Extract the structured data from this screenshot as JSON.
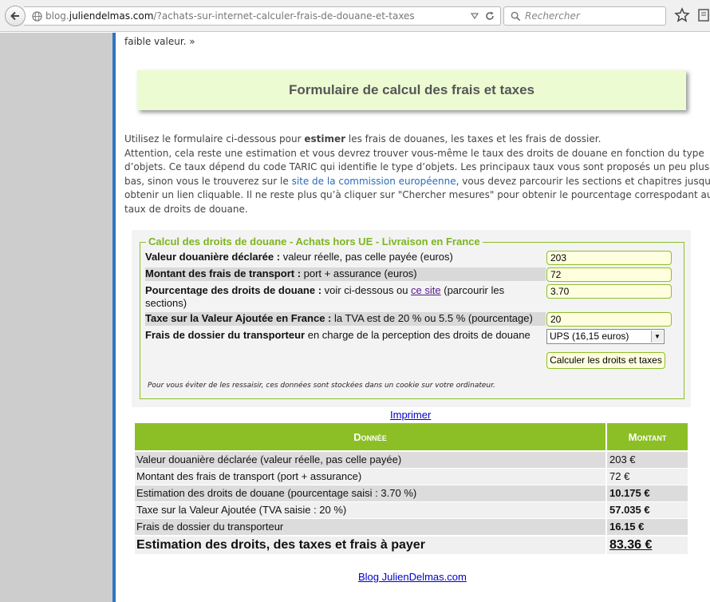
{
  "browser": {
    "url_prefix": "blog.",
    "url_domain": "juliendelmas.com",
    "url_path": "/?achats-sur-internet-calculer-frais-de-douane-et-taxes",
    "search_placeholder": "Rechercher"
  },
  "page": {
    "top_text": "faible valeur. »",
    "title": "Formulaire de calcul des frais et taxes",
    "intro": {
      "l1_a": "Utilisez le formulaire ci-dessous pour ",
      "l1_b": "estimer",
      "l1_c": " les frais de douanes, les taxes et les frais de dossier.",
      "l2": "Attention, cela reste une estimation et vous devrez trouver vous-même le taux des droits de douane en fonction du type",
      "l3": "d’objets. Ce taux dépend du code TARIC qui identifie le type d’objets. Les principaux taux vous sont proposés un peu plus",
      "l4_a": "bas, sinon vous le trouverez sur le ",
      "l4_link": "site de la commission européenne",
      "l4_b": ", vous devez parcourir les sections et chapitres jusqu’à",
      "l5": "obtenir un lien cliquable. Il ne reste plus qu’à cliquer sur \"Chercher mesures\" pour obtenir le pourcentage correspodant au",
      "l6": "taux de droits de douane."
    }
  },
  "form": {
    "legend": "Calcul des droits de douane - Achats hors UE - Livraison en France",
    "fields": [
      {
        "label_bold": "Valeur douanière déclarée :",
        "label_rest": " valeur réelle, pas celle payée (euros)",
        "value": "203"
      },
      {
        "label_bold": "Montant des frais de transport :",
        "label_rest": " port + assurance (euros)",
        "value": "72"
      },
      {
        "label_bold": "Pourcentage des droits de douane :",
        "label_rest": " voir ci-dessous ou ",
        "link": "ce site",
        "label_after": " (parcourir les",
        "label_line2": "sections)",
        "value": "3.70"
      },
      {
        "label_bold": "Taxe sur la Valeur Ajoutée en France :",
        "label_rest": " la TVA est de 20 % ou 5.5 % (pourcentage)",
        "value": "20"
      },
      {
        "label_bold": "Frais de dossier du transporteur",
        "label_rest": " en charge de la perception des droits de douane",
        "value": "UPS (16,15 euros)"
      }
    ],
    "submit_label": "Calculer les droits et taxes",
    "note": "Pour vous éviter de les ressaisir, ces données sont stockées dans un cookie sur votre ordinateur."
  },
  "print_label": "Imprimer",
  "results": {
    "headers": [
      "Donnée",
      "Montant"
    ],
    "rows": [
      {
        "label": "Valeur douanière déclarée (valeur réelle, pas celle payée)",
        "value": "203 €"
      },
      {
        "label": "Montant des frais de transport (port + assurance)",
        "value": "72 €"
      },
      {
        "label": "Estimation des droits de douane (pourcentage saisi : 3.70 %)",
        "value": "10.175 €"
      },
      {
        "label": "Taxe sur la Valeur Ajoutée (TVA saisie : 20 %)",
        "value": "57.035 €"
      },
      {
        "label": "Frais de dossier du transporteur",
        "value": "16.15 €"
      }
    ],
    "total_label": "Estimation des droits, des taxes et frais à payer",
    "total_value": "83.36 €"
  },
  "footer_link": "Blog JulienDelmas.com",
  "colors": {
    "accent_green": "#8cbf26",
    "blue_bar": "#2f74c2",
    "title_bg": "#ecfbd2"
  }
}
